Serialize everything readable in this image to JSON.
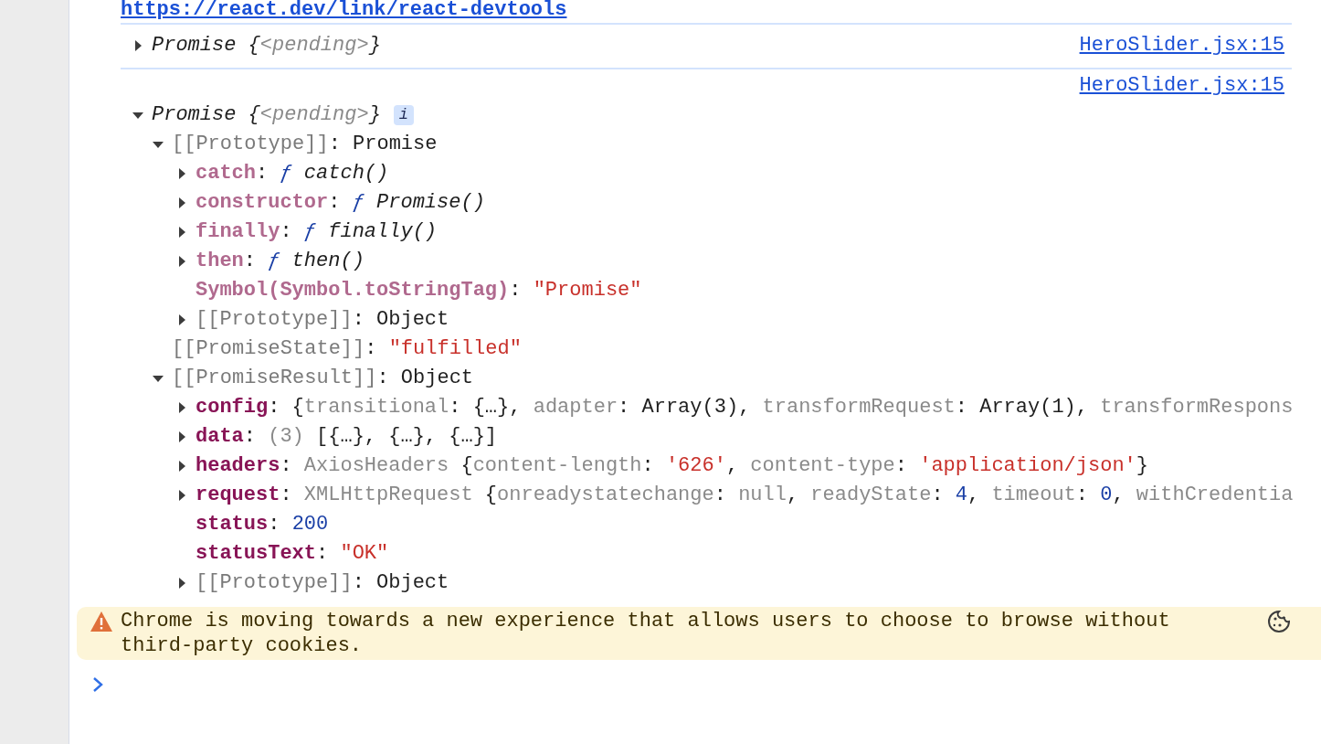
{
  "top_link": "https://react.dev/link/react-devtools",
  "messages": [
    {
      "source": "HeroSlider.jsx:15",
      "expanded": false,
      "summary": [
        {
          "t": "Promise {",
          "kind": "obj"
        },
        {
          "t": "<pending>",
          "kind": "muted"
        },
        {
          "t": "}",
          "kind": "obj"
        }
      ]
    },
    {
      "source": "HeroSlider.jsx:15",
      "expanded": true,
      "badge": "i",
      "summary": [
        {
          "t": "Promise {",
          "kind": "obj"
        },
        {
          "t": "<pending>",
          "kind": "muted"
        },
        {
          "t": "}",
          "kind": "obj"
        }
      ],
      "children": [
        {
          "expanded": true,
          "parts": [
            {
              "t": "[[Prototype]]",
              "kind": "internal"
            },
            {
              "t": ": Promise",
              "kind": "plain"
            }
          ],
          "children": [
            {
              "expanded": false,
              "parts": [
                {
                  "t": "catch",
                  "kind": "protokey"
                },
                {
                  "t": ": ",
                  "kind": "plain"
                },
                {
                  "t": "ƒ",
                  "kind": "fn"
                },
                {
                  "t": " catch()",
                  "kind": "obj"
                }
              ]
            },
            {
              "expanded": false,
              "parts": [
                {
                  "t": "constructor",
                  "kind": "protokey"
                },
                {
                  "t": ": ",
                  "kind": "plain"
                },
                {
                  "t": "ƒ",
                  "kind": "fn"
                },
                {
                  "t": " Promise()",
                  "kind": "obj"
                }
              ]
            },
            {
              "expanded": false,
              "parts": [
                {
                  "t": "finally",
                  "kind": "protokey"
                },
                {
                  "t": ": ",
                  "kind": "plain"
                },
                {
                  "t": "ƒ",
                  "kind": "fn"
                },
                {
                  "t": " finally()",
                  "kind": "obj"
                }
              ]
            },
            {
              "expanded": false,
              "parts": [
                {
                  "t": "then",
                  "kind": "protokey"
                },
                {
                  "t": ": ",
                  "kind": "plain"
                },
                {
                  "t": "ƒ",
                  "kind": "fn"
                },
                {
                  "t": " then()",
                  "kind": "obj"
                }
              ]
            },
            {
              "parts": [
                {
                  "t": "Symbol(Symbol.toStringTag)",
                  "kind": "protokey"
                },
                {
                  "t": ": ",
                  "kind": "plain"
                },
                {
                  "t": "\"Promise\"",
                  "kind": "string"
                }
              ]
            },
            {
              "expanded": false,
              "parts": [
                {
                  "t": "[[Prototype]]",
                  "kind": "internal"
                },
                {
                  "t": ": Object",
                  "kind": "plain"
                }
              ]
            }
          ]
        },
        {
          "parts": [
            {
              "t": "[[PromiseState]]",
              "kind": "internal"
            },
            {
              "t": ": ",
              "kind": "plain"
            },
            {
              "t": "\"fulfilled\"",
              "kind": "string"
            }
          ]
        },
        {
          "expanded": true,
          "parts": [
            {
              "t": "[[PromiseResult]]",
              "kind": "internal"
            },
            {
              "t": ": Object",
              "kind": "plain"
            }
          ],
          "children": [
            {
              "expanded": false,
              "parts": [
                {
                  "t": "config",
                  "kind": "key"
                },
                {
                  "t": ": {",
                  "kind": "plain"
                },
                {
                  "t": "transitional",
                  "kind": "muted"
                },
                {
                  "t": ": {…}, ",
                  "kind": "plain"
                },
                {
                  "t": "adapter",
                  "kind": "muted"
                },
                {
                  "t": ": Array(3), ",
                  "kind": "plain"
                },
                {
                  "t": "transformRequest",
                  "kind": "muted"
                },
                {
                  "t": ": Array(1), ",
                  "kind": "plain"
                },
                {
                  "t": "transformRespons",
                  "kind": "muted"
                }
              ]
            },
            {
              "expanded": false,
              "parts": [
                {
                  "t": "data",
                  "kind": "key"
                },
                {
                  "t": ": ",
                  "kind": "plain"
                },
                {
                  "t": "(3)",
                  "kind": "muted"
                },
                {
                  "t": " [{…}, {…}, {…}]",
                  "kind": "plain"
                }
              ]
            },
            {
              "expanded": false,
              "parts": [
                {
                  "t": "headers",
                  "kind": "key"
                },
                {
                  "t": ": ",
                  "kind": "plain"
                },
                {
                  "t": "AxiosHeaders",
                  "kind": "muted"
                },
                {
                  "t": " {",
                  "kind": "plain"
                },
                {
                  "t": "content-length",
                  "kind": "muted"
                },
                {
                  "t": ": ",
                  "kind": "plain"
                },
                {
                  "t": "'626'",
                  "kind": "string"
                },
                {
                  "t": ", ",
                  "kind": "plain"
                },
                {
                  "t": "content-type",
                  "kind": "muted"
                },
                {
                  "t": ": ",
                  "kind": "plain"
                },
                {
                  "t": "'application/json'",
                  "kind": "string"
                },
                {
                  "t": "}",
                  "kind": "plain"
                }
              ]
            },
            {
              "expanded": false,
              "parts": [
                {
                  "t": "request",
                  "kind": "key"
                },
                {
                  "t": ": ",
                  "kind": "plain"
                },
                {
                  "t": "XMLHttpRequest",
                  "kind": "muted"
                },
                {
                  "t": " {",
                  "kind": "plain"
                },
                {
                  "t": "onreadystatechange",
                  "kind": "muted"
                },
                {
                  "t": ": ",
                  "kind": "plain"
                },
                {
                  "t": "null",
                  "kind": "muted"
                },
                {
                  "t": ", ",
                  "kind": "plain"
                },
                {
                  "t": "readyState",
                  "kind": "muted"
                },
                {
                  "t": ": ",
                  "kind": "plain"
                },
                {
                  "t": "4",
                  "kind": "number"
                },
                {
                  "t": ", ",
                  "kind": "plain"
                },
                {
                  "t": "timeout",
                  "kind": "muted"
                },
                {
                  "t": ": ",
                  "kind": "plain"
                },
                {
                  "t": "0",
                  "kind": "number"
                },
                {
                  "t": ", ",
                  "kind": "plain"
                },
                {
                  "t": "withCredentia",
                  "kind": "muted"
                }
              ]
            },
            {
              "parts": [
                {
                  "t": "status",
                  "kind": "key"
                },
                {
                  "t": ": ",
                  "kind": "plain"
                },
                {
                  "t": "200",
                  "kind": "number"
                }
              ]
            },
            {
              "parts": [
                {
                  "t": "statusText",
                  "kind": "key"
                },
                {
                  "t": ": ",
                  "kind": "plain"
                },
                {
                  "t": "\"OK\"",
                  "kind": "string"
                }
              ]
            },
            {
              "expanded": false,
              "parts": [
                {
                  "t": "[[Prototype]]",
                  "kind": "internal"
                },
                {
                  "t": ": Object",
                  "kind": "plain"
                }
              ]
            }
          ]
        }
      ]
    }
  ],
  "warning": {
    "text": "Chrome is moving towards a new experience that allows users to choose to browse without third-party cookies."
  }
}
